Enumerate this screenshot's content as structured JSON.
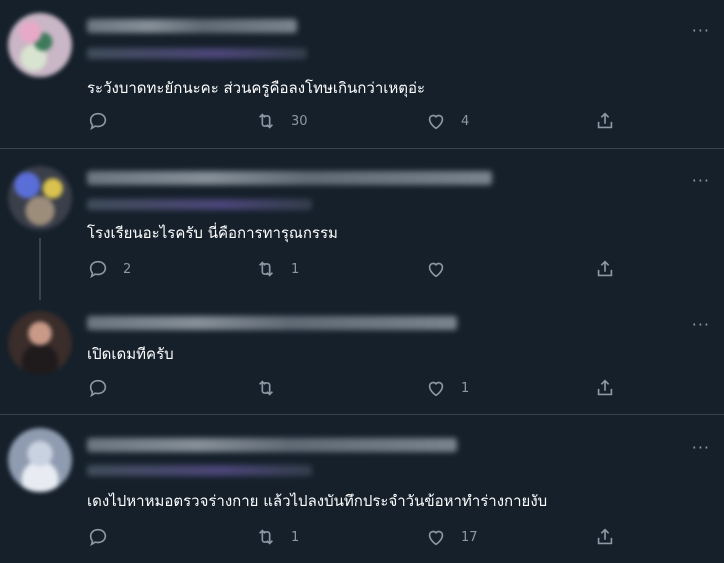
{
  "tweets": [
    {
      "text": "ระวังบาดทะยักนะคะ ส่วนครูคือลงโทษเกินกว่าเหตุอ่ะ",
      "reply_count": "",
      "retweet_count": "30",
      "like_count": "4"
    },
    {
      "text": "โรงเรียนอะไรครับ นี่คือการทารุณกรรม",
      "reply_count": "2",
      "retweet_count": "1",
      "like_count": ""
    },
    {
      "text": "เปิดเดมทีครับ",
      "reply_count": "",
      "retweet_count": "",
      "like_count": "1"
    },
    {
      "text": "เดงไปหาหมอตรวจร่างกาย แล้วไปลงบันทึกประจำวันข้อหาทำร่างกายงับ",
      "reply_count": "",
      "retweet_count": "1",
      "like_count": "17"
    }
  ],
  "more_symbol": "···",
  "icons": [
    "reply-icon",
    "retweet-icon",
    "like-icon",
    "share-icon"
  ],
  "colors": {
    "background": "#15202b",
    "text": "#ffffff",
    "muted": "#8b98a5",
    "divider": "#38444d"
  }
}
